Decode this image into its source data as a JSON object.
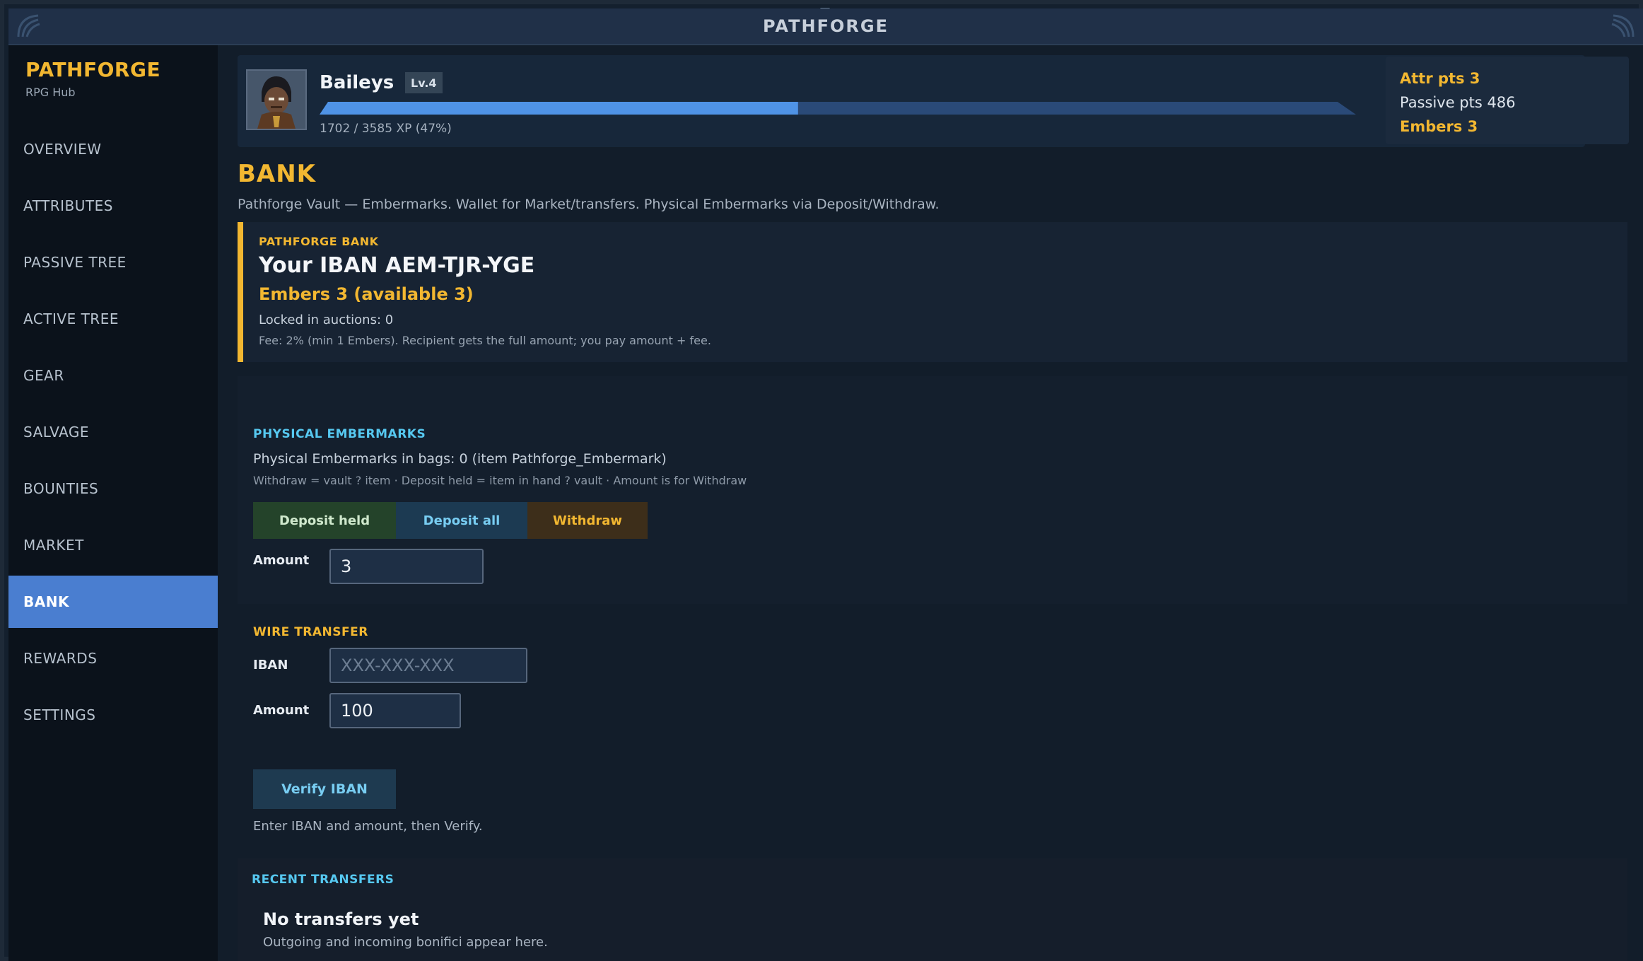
{
  "window": {
    "title": "PATHFORGE"
  },
  "sidebar": {
    "brand": "PATHFORGE",
    "subtitle": "RPG Hub",
    "items": [
      {
        "label": "OVERVIEW",
        "active": false
      },
      {
        "label": "ATTRIBUTES",
        "active": false
      },
      {
        "label": "PASSIVE TREE",
        "active": false
      },
      {
        "label": "ACTIVE TREE",
        "active": false
      },
      {
        "label": "GEAR",
        "active": false
      },
      {
        "label": "SALVAGE",
        "active": false
      },
      {
        "label": "BOUNTIES",
        "active": false
      },
      {
        "label": "MARKET",
        "active": false
      },
      {
        "label": "BANK",
        "active": true
      },
      {
        "label": "REWARDS",
        "active": false
      },
      {
        "label": "SETTINGS",
        "active": false
      }
    ]
  },
  "header": {
    "character_name": "Baileys",
    "level": "Lv.4",
    "xp_text": "1702 / 3585 XP (47%)",
    "xp_progress": 0.47,
    "stats": {
      "attr_pts": "Attr pts  3",
      "passive_pts": "Passive pts  486",
      "embers": "Embers  3"
    }
  },
  "bank": {
    "title": "BANK",
    "description": "Pathforge Vault — Embermarks. Wallet for Market/transfers. Physical Embermarks via Deposit/Withdraw.",
    "vault": {
      "label": "PATHFORGE BANK",
      "iban_line": "Your IBAN  AEM-TJR-YGE",
      "embers_line": "Embers  3  (available 3)",
      "locked_line": "Locked in auctions: 0",
      "fee_line": "Fee: 2% (min 1 Embers). Recipient gets the full amount; you pay amount + fee."
    },
    "physical": {
      "label": "PHYSICAL EMBERMARKS",
      "bags_line": "Physical Embermarks in bags: 0  (item Pathforge_Embermark)",
      "help_line": "Withdraw = vault ? item · Deposit held = item in hand ? vault · Amount is for Withdraw",
      "deposit_held": "Deposit held",
      "deposit_all": "Deposit all",
      "withdraw": "Withdraw",
      "amount_label": "Amount",
      "amount_value": "3"
    },
    "wire": {
      "label": "WIRE TRANSFER",
      "iban_label": "IBAN",
      "iban_placeholder": "XXX-XXX-XXX",
      "amount_label": "Amount",
      "amount_value": "100",
      "verify_button": "Verify IBAN",
      "hint": "Enter IBAN and amount, then Verify."
    },
    "recent": {
      "label": "RECENT TRANSFERS",
      "empty_title": "No transfers yet",
      "empty_sub": "Outgoing and incoming bonifici appear here."
    }
  },
  "colors": {
    "accent_gold": "#f2b731",
    "accent_cyan": "#56c8f0",
    "nav_active": "#4a7ed0",
    "xp_fill": "#4f93e6"
  },
  "icons": {
    "avatar": "character-portrait-icon",
    "corner": "corner-ornament-icon"
  }
}
